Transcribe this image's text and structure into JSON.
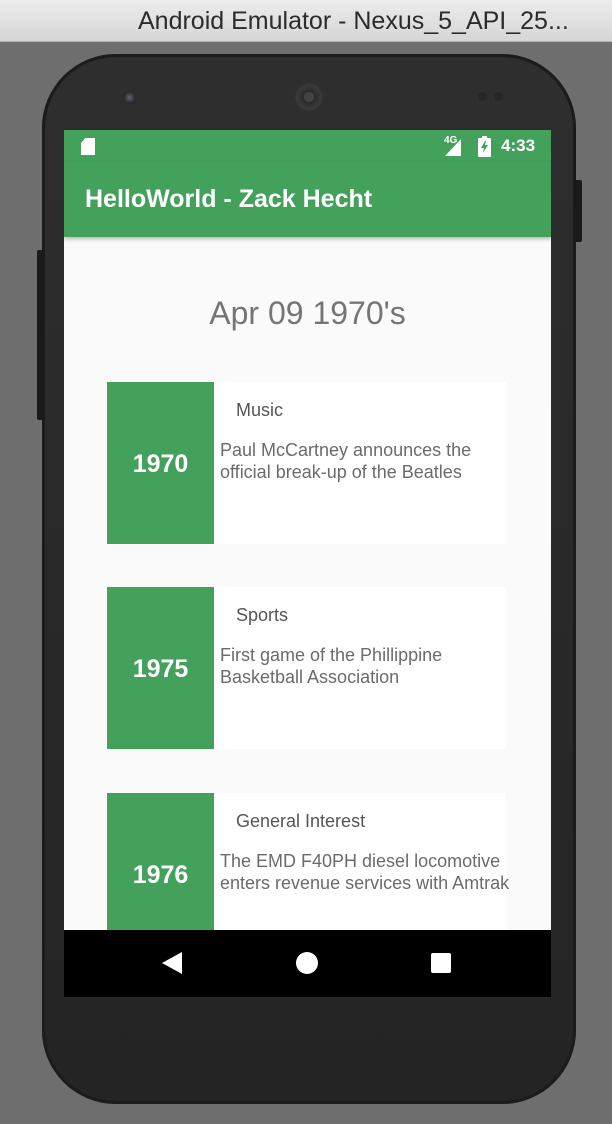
{
  "window": {
    "title": "Android Emulator - Nexus_5_API_25..."
  },
  "status_bar": {
    "network_type": "4G",
    "time": "4:33",
    "icons": [
      "sd-card-icon",
      "signal-icon",
      "battery-charging-icon"
    ]
  },
  "app_bar": {
    "title": "HelloWorld - Zack Hecht"
  },
  "colors": {
    "primary": "#43a15c",
    "background": "#fafafa",
    "card": "#ffffff"
  },
  "main": {
    "heading": "Apr 09 1970's",
    "events": [
      {
        "year": "1970",
        "category": "Music",
        "description": "Paul McCartney announces the official break-up of the Beatles"
      },
      {
        "year": "1975",
        "category": "Sports",
        "description": "First game of the Phillippine Basketball Association"
      },
      {
        "year": "1976",
        "category": "General Interest",
        "description": "The EMD F40PH diesel locomotive enters revenue services with Amtrak"
      }
    ]
  },
  "nav_bar": {
    "buttons": [
      "back-icon",
      "home-icon",
      "recents-icon"
    ]
  }
}
